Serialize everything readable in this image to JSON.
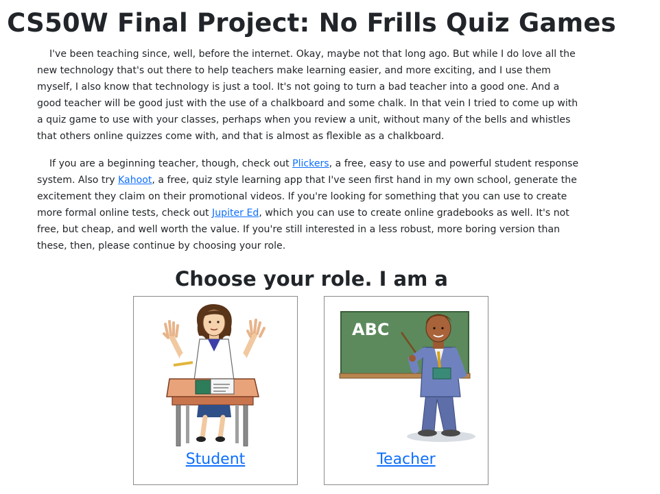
{
  "page": {
    "title": "CS50W Final Project: No Frills Quiz Games"
  },
  "intro": {
    "paragraph1": "I've been teaching since, well, before the internet. Okay, maybe not that long ago. But while I do love all the new technology that's out there to help teachers make learning easier, and more exciting, and I use them myself, I also know that technology is just a tool. It's not going to turn a bad teacher into a good one. And a good teacher will be good just with the use of a chalkboard and some chalk. In that vein I tried to come up with a quiz game to use with your classes, perhaps when you review a unit, without many of the bells and whistles that others online quizzes come with, and that is almost as flexible as a chalkboard.",
    "paragraph2": {
      "part1": "If you are a beginning teacher, though, check out ",
      "link1": "Plickers",
      "part2": ", a free, easy to use and powerful student response system. Also try ",
      "link2": "Kahoot",
      "part3": ", a free, quiz style learning app that I've seen first hand in my own school, generate the excitement they claim on their promotional videos. If you're looking for something that you can use to create more formal online tests, check out ",
      "link3": "Jupiter Ed",
      "part4": ", which you can use to create online gradebooks as well. It's not free, but cheap, and well worth the value. If you're still interested in a less robust, more boring version than these, then, please continue by choosing your role."
    }
  },
  "roles": {
    "heading": "Choose your role. I am a",
    "student": {
      "label": "Student",
      "icon": "student-at-desk-illustration"
    },
    "teacher": {
      "label": "Teacher",
      "icon": "teacher-at-chalkboard-illustration",
      "board_text": "ABC"
    }
  },
  "colors": {
    "link": "#0d6efd",
    "text": "#212529",
    "chalkboard": "#4e7a4e",
    "card_border": "#8a8a8a"
  }
}
